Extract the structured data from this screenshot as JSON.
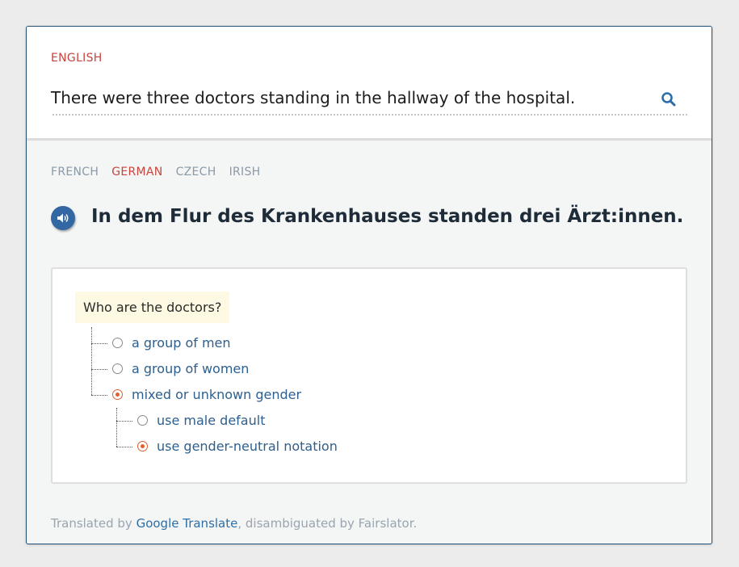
{
  "source": {
    "language": "ENGLISH",
    "text": "There were three doctors standing in the hallway of the hospital.",
    "search_icon": "search-icon"
  },
  "target": {
    "tabs": [
      {
        "label": "FRENCH",
        "active": false
      },
      {
        "label": "GERMAN",
        "active": true
      },
      {
        "label": "CZECH",
        "active": false
      },
      {
        "label": "IRISH",
        "active": false
      }
    ],
    "speaker_icon": "speaker-icon",
    "translation": "In dem Flur des Krankenhauses standen drei Ärzt:innen."
  },
  "disambiguation": {
    "question": "Who are the doctors?",
    "options": [
      {
        "label": "a group of men",
        "selected": false
      },
      {
        "label": "a group of women",
        "selected": false
      },
      {
        "label": "mixed or unknown gender",
        "selected": true
      }
    ],
    "sub_options": [
      {
        "label": "use male default",
        "selected": false
      },
      {
        "label": "use gender-neutral notation",
        "selected": true
      }
    ]
  },
  "footer": {
    "prefix": "Translated by ",
    "link": "Google Translate",
    "suffix": ", disambiguated by Fairslator."
  },
  "colors": {
    "accent_red": "#c8453f",
    "link_blue": "#2d5f8f",
    "speaker_blue": "#3367a3",
    "radio_selected": "#e06030",
    "question_bg": "#fdf9e3"
  }
}
